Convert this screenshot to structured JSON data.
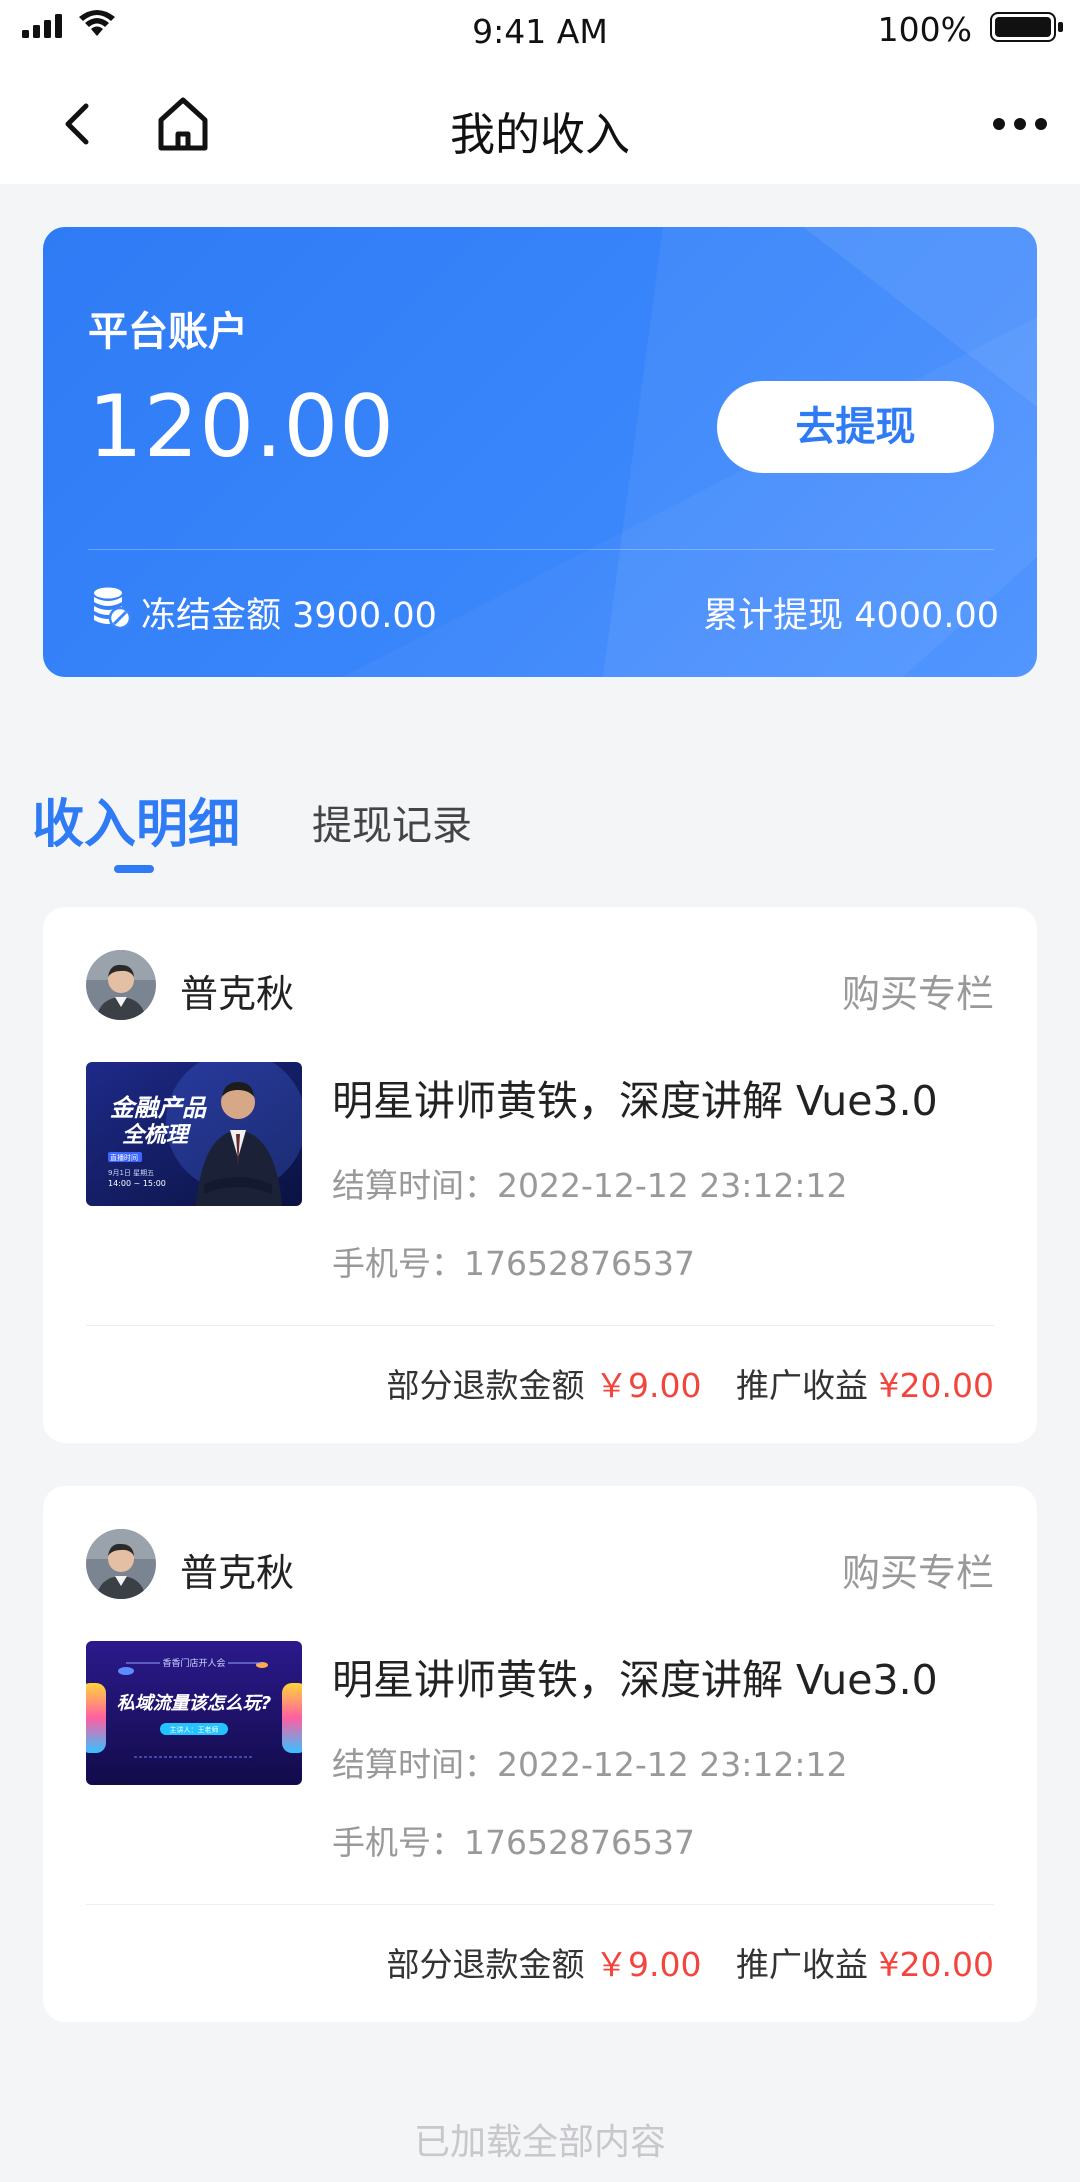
{
  "status_bar": {
    "time": "9:41 AM",
    "battery": "100%"
  },
  "nav": {
    "title": "我的收入"
  },
  "account": {
    "label": "平台账户",
    "balance": "120.00",
    "withdraw_button": "去提现",
    "frozen": "冻结金额 3900.00",
    "total_withdrawn": "累计提现 4000.00",
    "accent_color": "#2f7bf5"
  },
  "tabs": [
    {
      "label": "收入明细",
      "active": true
    },
    {
      "label": "提现记录",
      "active": false
    }
  ],
  "records": [
    {
      "username": "普克秋",
      "type": "购买专栏",
      "course_title": "明星讲师黄铁，深度讲解 Vue3.0",
      "settle_time": "结算时间：2022-12-12 23:12:12",
      "phone": "手机号：17652876537",
      "refund_label": "部分退款金额",
      "refund_amount": "￥9.00",
      "income_label": "推广收益",
      "income_amount": "¥20.00",
      "thumb": {
        "line1": "金融产品",
        "line2": "全梳理",
        "badge": "直播时间",
        "date": "9月1日 星期五",
        "time": "14:00 ~ 15:00"
      }
    },
    {
      "username": "普克秋",
      "type": "购买专栏",
      "course_title": "明星讲师黄铁，深度讲解 Vue3.0",
      "settle_time": "结算时间：2022-12-12 23:12:12",
      "phone": "手机号：17652876537",
      "refund_label": "部分退款金额",
      "refund_amount": "￥9.00",
      "income_label": "推广收益",
      "income_amount": "¥20.00",
      "thumb": {
        "header": "香香门店开人会",
        "line1": "私域流量该怎么玩?",
        "badge": "主讲人：王老师"
      }
    }
  ],
  "footer": "已加载全部内容"
}
